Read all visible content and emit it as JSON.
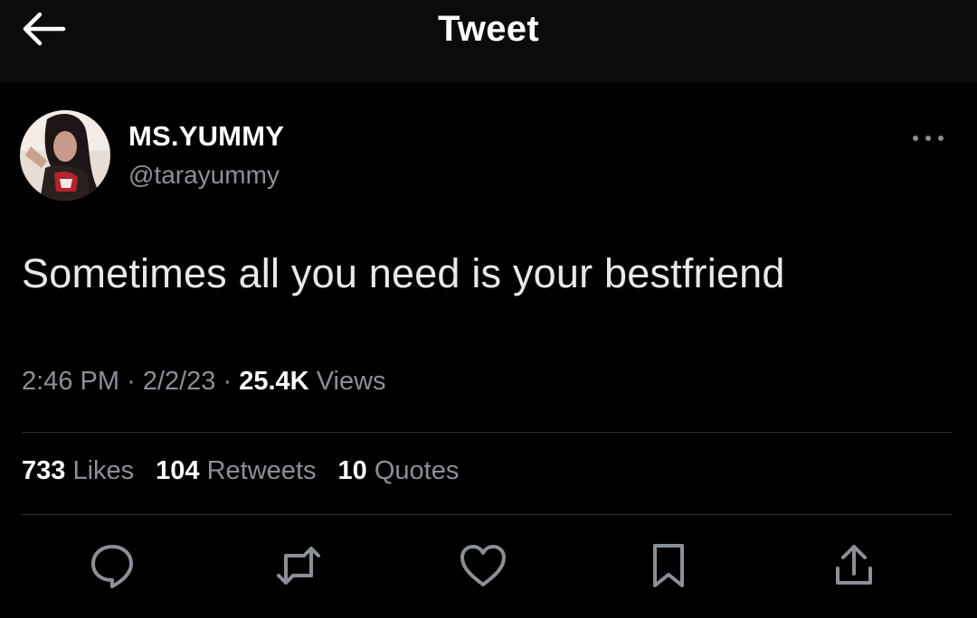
{
  "header": {
    "title": "Tweet",
    "back_icon": "arrow-left-icon"
  },
  "tweet": {
    "display_name": "MS.YUMMY",
    "handle": "@tarayummy",
    "text": "Sometimes all you need is your bestfriend",
    "time": "2:46 PM",
    "date": "2/2/23",
    "views_count": "25.4K",
    "views_label": "Views",
    "separator": "·"
  },
  "stats": {
    "likes_count": "733",
    "likes_label": "Likes",
    "retweets_count": "104",
    "retweets_label": "Retweets",
    "quotes_count": "10",
    "quotes_label": "Quotes"
  },
  "actions": [
    "reply-icon",
    "retweet-icon",
    "like-icon",
    "bookmark-icon",
    "share-icon"
  ],
  "colors": {
    "background": "#000000",
    "primary_text": "#e7e9ea",
    "secondary_text": "#8b9097",
    "divider": "#2f3336"
  }
}
